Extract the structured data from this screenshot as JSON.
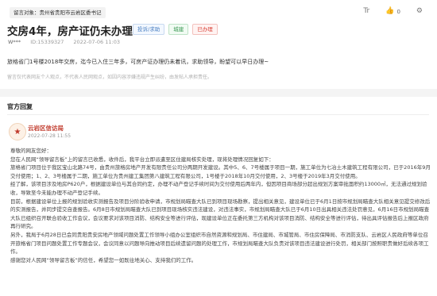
{
  "header": {
    "target_label": "留言对象：",
    "target_value": "贵州省贵阳市云岩区委书记",
    "font_size_icon": "Tr",
    "more_icon": "gear-icon",
    "like_count": "0"
  },
  "message": {
    "title": "交房4年，房产证仍未办理",
    "tags": [
      "投诉/求助",
      "城建",
      "已办理"
    ],
    "user": "W***",
    "id": "ID:15339327",
    "datetime": "2022-07-06 11:03",
    "content": "旅格省门1号楼2018年交房，迄今已入住三年多，可房产证办理仍未着讯，求助领导，盼望可以早日办理~",
    "disclaimer": "留言仅代表网友个人观点，不代表人民网观点，如因内容涉嫌违规产生纠纷，由发帖人承担责任。"
  },
  "reply_section": {
    "title": "官方回复",
    "org": "云岩区信访局",
    "date": "2022-07-28 11:55",
    "paragraphs": [
      "尊敬的网友您好：",
      "您在人民网“领导留言板”上的留言已收悉，收件后，我平台立即派遣至区住建局核实处理，现将处理情况回复如下：",
      "旅格省门项目位于我区宝山北路74号，由贵州旅格房地产开发有限责任公司分两期开发建设。其中5、6、7号楼属于项目一期，施工单位为七冶土木建筑工程有限公司，已于2016年9月交付使用；1、2、3号楼属于二期，施工单位为贵州建工集团第八建筑工程有限公司，1号楼于2018年10月交付使用，2、3号楼于2019年3月交付使用。",
      "经了解，该项目涉及地房P620户，根据建设单位与其合同约定，办理不动产登记手续时间为交付使用后两年内，但因项目商场部分超出规划方案审批面积约13000㎡，无法通过规划验收，导致至今未能办理不动产登记手续。",
      "目前，根据建设单位上报的规划验收实测报告及项目分阶验收申请，市规划局瞄查大队已到项目现场勘察，提出相关意见，建设单位已于6月1日按市规划局瞄查大队相关意见提交修改后的实测报告，并同步提交自查报告。6月8日市规划局瞄查大队已到项目现场核实违法建设，对违法事实，市规划局瞄查大队已于6月10日出具相关违法处罚意见，6月16日市规划局瞄查大队已组织召开联合验收工作会议，会议要求对该项目消防、结构安全等进行评估，现建设单位正在委托第三方机构对该项目消防、结构安全等进行评估，待出具评估报告后上报区政府再行研究。",
      "另外，我局于6月28日已会同贵阳贵安房地产领域问题处置工作领导小组办公室组织市自然资源和规划局、市住建局、市城管局、市住房保障局、市消防支队、云岩区人民政府等单位召开旅格省门项目问题处置工作专题会议，会议同意以问题导向推动项目后续遗留问题的处理工作，市规划局瞄查大队负责对该项目违法建设进行处罚，相关部门按照职责做好后续各项工作。",
      "感谢您对人民网“领导留言板”的信任，希望您一如既往地关心、支持我们的工作。"
    ]
  }
}
